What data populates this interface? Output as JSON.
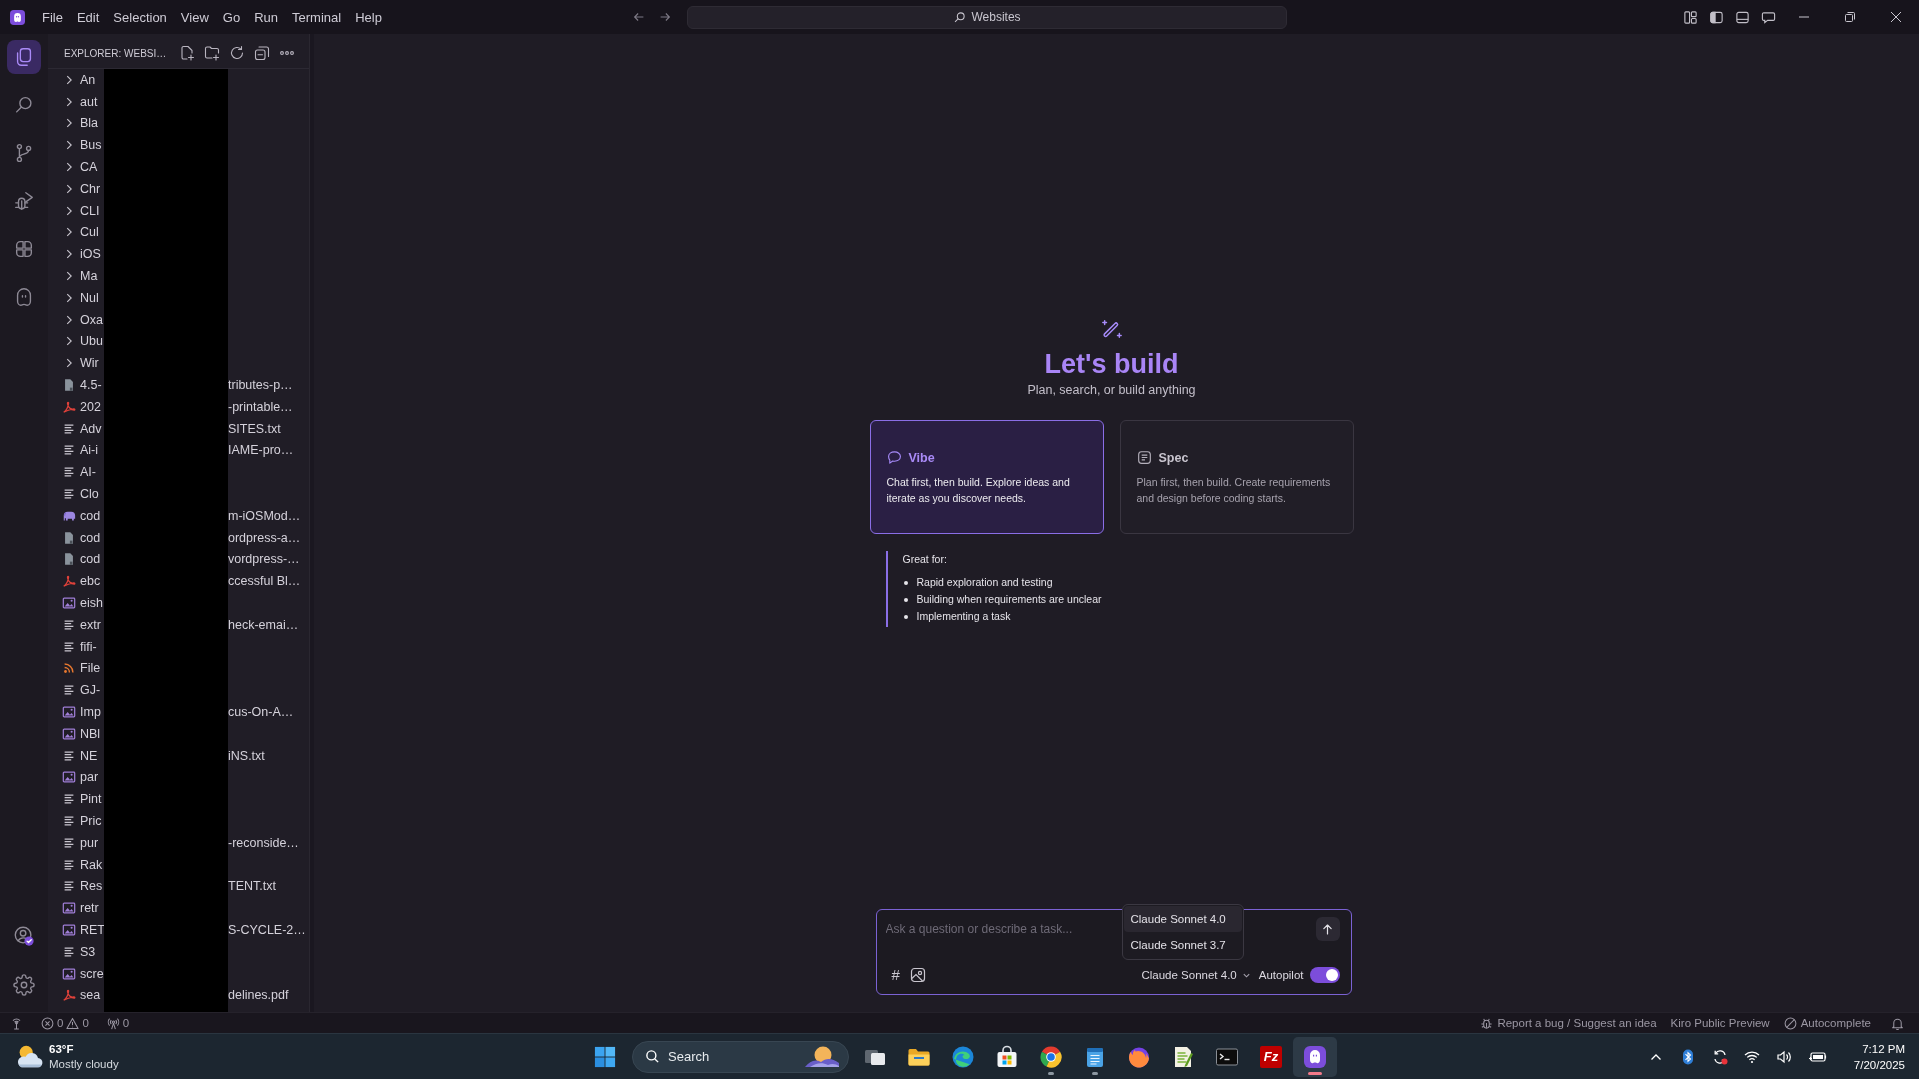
{
  "title_bar": {
    "menu": [
      "File",
      "Edit",
      "Selection",
      "View",
      "Go",
      "Run",
      "Terminal",
      "Help"
    ],
    "search": "Websites"
  },
  "activity_bar": {
    "items": [
      {
        "kind": "explorer",
        "selected": true
      },
      {
        "kind": "search",
        "selected": false
      },
      {
        "kind": "source-control",
        "selected": false
      },
      {
        "kind": "run-debug",
        "selected": false
      },
      {
        "kind": "extensions",
        "selected": false
      },
      {
        "kind": "ghost",
        "selected": false
      }
    ]
  },
  "explorer": {
    "title": "EXPLORER: WEBSI…",
    "folders": [
      {
        "name": "An",
        "expanded": false
      },
      {
        "name": "aut",
        "expanded": false
      },
      {
        "name": "Bla",
        "expanded": false
      },
      {
        "name": "Bus",
        "expanded": false
      },
      {
        "name": "CA",
        "expanded": false
      },
      {
        "name": "Chr",
        "expanded": false
      },
      {
        "name": "CLI",
        "expanded": false
      },
      {
        "name": "Cul",
        "expanded": false
      },
      {
        "name": "iOS",
        "expanded": false
      },
      {
        "name": "Ma",
        "expanded": false
      },
      {
        "name": "Nul",
        "expanded": false
      },
      {
        "name": "Oxa",
        "expanded": false
      },
      {
        "name": "Ubu",
        "expanded": false
      },
      {
        "name": "Wir",
        "expanded": false
      }
    ],
    "files": [
      {
        "kind": "binary",
        "name": "4.5-",
        "name_end": "tributes-p…"
      },
      {
        "kind": "pdf",
        "name": "202",
        "name_end": "-printable…"
      },
      {
        "kind": "text",
        "name": "Adv",
        "name_end": "SITES.txt"
      },
      {
        "kind": "text",
        "name": "Ai-i",
        "name_end": "IAME-pro…"
      },
      {
        "kind": "text",
        "name": "AI-"
      },
      {
        "kind": "text",
        "name": "Clo"
      },
      {
        "kind": "php",
        "name": "cod",
        "name_end": "m-iOSMod…"
      },
      {
        "kind": "binary",
        "name": "cod",
        "name_end": "ordpress-a…"
      },
      {
        "kind": "binary",
        "name": "cod",
        "name_end": "vordpress-…"
      },
      {
        "kind": "pdf",
        "name": "ebc",
        "name_end": "ccessful Bl…"
      },
      {
        "kind": "image",
        "name": "eish"
      },
      {
        "kind": "text",
        "name": "extr",
        "name_end": "heck-emai…"
      },
      {
        "kind": "text",
        "name": "fifi-"
      },
      {
        "kind": "rss",
        "name": "File"
      },
      {
        "kind": "text",
        "name": "GJ-"
      },
      {
        "kind": "image",
        "name": "Imp",
        "name_end": "cus-On-A…"
      },
      {
        "kind": "image",
        "name": "NBl"
      },
      {
        "kind": "text",
        "name": "NE",
        "name_end": "iNS.txt"
      },
      {
        "kind": "image",
        "name": "par"
      },
      {
        "kind": "text",
        "name": "Pint"
      },
      {
        "kind": "text",
        "name": "Pric"
      },
      {
        "kind": "text",
        "name": "pur",
        "name_end": "-reconside…"
      },
      {
        "kind": "text",
        "name": "Rak"
      },
      {
        "kind": "text",
        "name": "Res",
        "name_end": "TENT.txt"
      },
      {
        "kind": "image",
        "name": "retr"
      },
      {
        "kind": "image",
        "name": "RET",
        "name_end": "S-CYCLE-2…"
      },
      {
        "kind": "text",
        "name": "S3"
      },
      {
        "kind": "image",
        "name": "scre"
      },
      {
        "kind": "pdf",
        "name": "sea",
        "name_end": "delines.pdf"
      }
    ]
  },
  "welcome": {
    "title": "Let's build",
    "subtitle": "Plan, search, or build anything",
    "modes": [
      {
        "kind": "vibe",
        "title": "Vibe",
        "description": "Chat first, then build. Explore ideas and iterate as you discover needs.",
        "selected": true
      },
      {
        "kind": "spec",
        "title": "Spec",
        "description": "Plan first, then build. Create requirements and design before coding starts.",
        "selected": false
      }
    ],
    "great_for": {
      "title": "Great for:",
      "items": [
        "Rapid exploration and testing",
        "Building when requirements are unclear",
        "Implementing a task"
      ]
    }
  },
  "chat": {
    "placeholder": "Ask a question or describe a task...",
    "context_symbol": "#",
    "model": "Claude Sonnet 4.0",
    "model_menu": [
      {
        "label": "Claude Sonnet 4.0",
        "selected": true
      },
      {
        "label": "Claude Sonnet 3.7",
        "selected": false
      }
    ],
    "autopilot": {
      "label": "Autopilot",
      "on": true
    }
  },
  "status_bar": {
    "errors": "0",
    "warnings": "0",
    "ports": "0",
    "items": [
      {
        "kind": "bug",
        "label": "Report a bug / Suggest an idea"
      },
      {
        "kind": "plain",
        "label": "Kiro Public Preview"
      },
      {
        "kind": "autocomplete",
        "label": "Autocomplete"
      }
    ]
  },
  "taskbar": {
    "weather": {
      "temperature": "63°F",
      "condition": "Mostly cloudy"
    },
    "search": "Search",
    "apps": [
      {
        "kind": "task-view",
        "running": false,
        "selected": false
      },
      {
        "kind": "folder",
        "running": false,
        "selected": false
      },
      {
        "kind": "wave",
        "running": false,
        "selected": false
      },
      {
        "kind": "store",
        "running": false,
        "selected": false
      },
      {
        "kind": "tricolor",
        "running": true,
        "selected": false
      },
      {
        "kind": "notepad",
        "running": true,
        "selected": false
      },
      {
        "kind": "fox",
        "running": false,
        "selected": false
      },
      {
        "kind": "doc-pen",
        "running": false,
        "selected": false
      },
      {
        "kind": "terminal",
        "running": false,
        "selected": false
      },
      {
        "kind": "tile",
        "glyph": "Fz",
        "running": false,
        "selected": false
      },
      {
        "kind": "ghost",
        "running": true,
        "selected": true
      }
    ],
    "time": "7:12 PM",
    "date": "7/20/2025"
  }
}
